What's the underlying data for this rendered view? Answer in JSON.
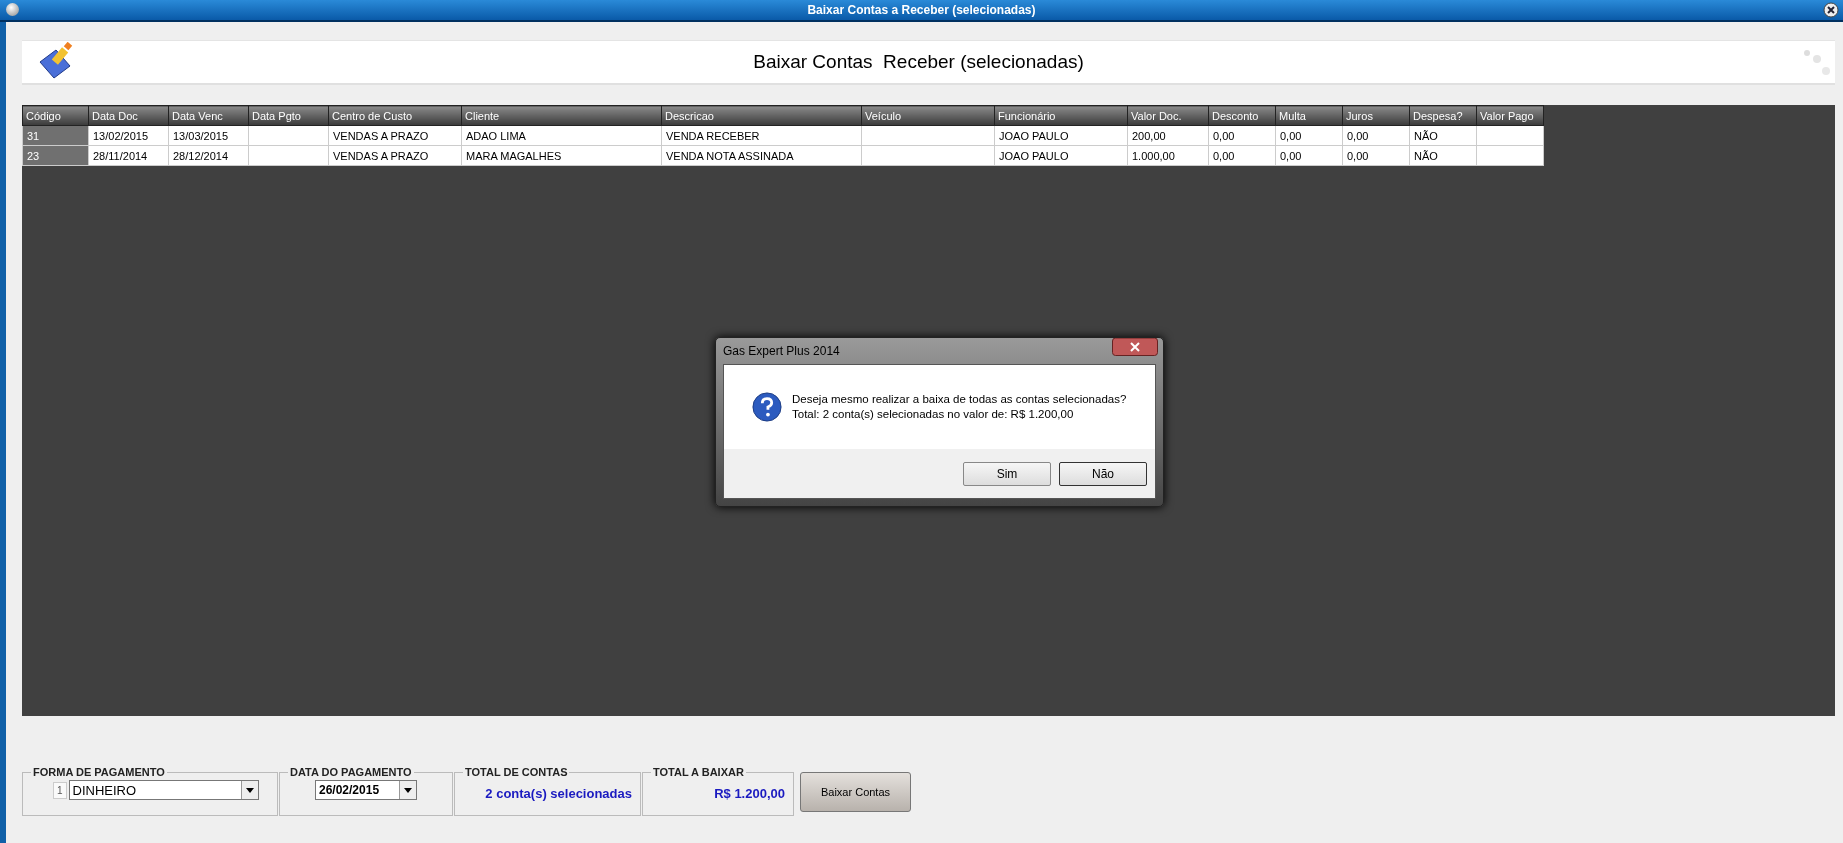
{
  "window": {
    "title": "Baixar Contas a Receber (selecionadas)"
  },
  "header": {
    "title": "Baixar Contas  Receber (selecionadas)"
  },
  "table": {
    "columns": [
      "Código",
      "Data Doc",
      "Data Venc",
      "Data Pgto",
      "Centro de Custo",
      "Cliente",
      "Descricao",
      "Veículo",
      "Funcionário",
      "Valor Doc.",
      "Desconto",
      "Multa",
      "Juros",
      "Despesa?",
      "Valor Pago"
    ],
    "rows": [
      [
        "31",
        "13/02/2015",
        "13/03/2015",
        "",
        "VENDAS A PRAZO",
        "ADAO LIMA",
        "VENDA RECEBER",
        "",
        "JOAO PAULO",
        "200,00",
        "0,00",
        "0,00",
        "0,00",
        "NÃO",
        ""
      ],
      [
        "23",
        "28/11/2014",
        "28/12/2014",
        "",
        "VENDAS A PRAZO",
        "MARA MAGALHES",
        "VENDA NOTA ASSINADA",
        "",
        "JOAO PAULO",
        "1.000,00",
        "0,00",
        "0,00",
        "0,00",
        "NÃO",
        ""
      ]
    ]
  },
  "dialog": {
    "title": "Gas Expert Plus 2014",
    "message": [
      "Deseja mesmo realizar a baixa de todas as contas selecionadas?",
      "Total: 2 conta(s) selecionadas no valor de: R$ 1.200,00"
    ],
    "buttons": [
      "Sim",
      "Não"
    ]
  },
  "footer": {
    "forma_pagamento": {
      "label": "FORMA DE PAGAMENTO",
      "code": "1",
      "value": "DINHEIRO"
    },
    "data_pagamento": {
      "label": "DATA DO PAGAMENTO",
      "value": "26/02/2015"
    },
    "total_contas": {
      "label": "TOTAL DE CONTAS",
      "value": "2 conta(s) selecionadas"
    },
    "total_baixar": {
      "label": "TOTAL A BAIXAR",
      "value": "R$ 1.200,00"
    },
    "button": "Baixar Contas"
  }
}
